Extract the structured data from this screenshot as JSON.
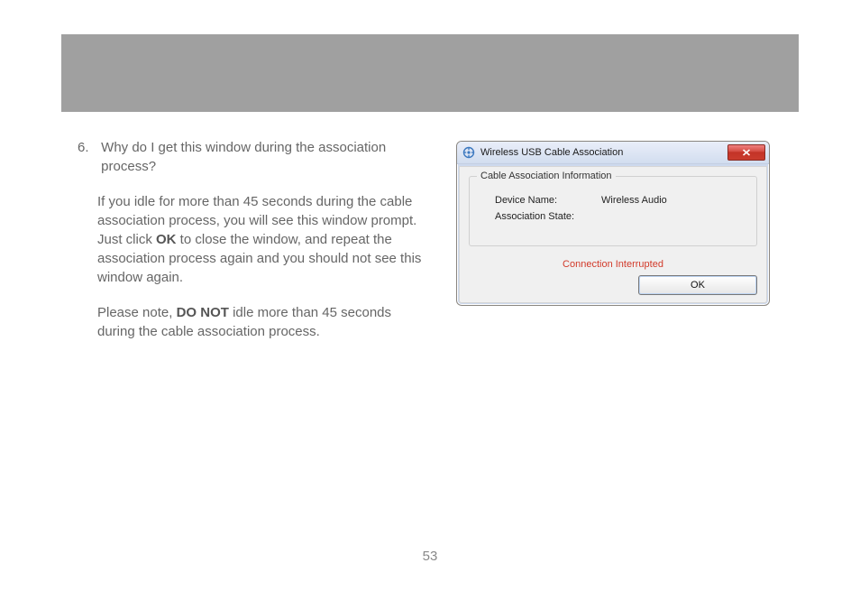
{
  "page_number": "53",
  "faq": {
    "number": "6.",
    "question": "Why do I get this window during the association process?",
    "answer1_pre": "If you idle for more than 45 seconds during the cable association process, you will see this window prompt.  Just click ",
    "answer1_bold": "OK",
    "answer1_post": " to close the window, and repeat the association process again and you should not see this window again.",
    "answer2_pre": "Please note, ",
    "answer2_bold": "DO NOT",
    "answer2_post": " idle more than 45 seconds during the cable association process."
  },
  "dialog": {
    "title": "Wireless USB Cable Association",
    "groupbox_title": "Cable Association Information",
    "device_name_label": "Device Name:",
    "device_name_value": "Wireless Audio",
    "assoc_state_label": "Association State:",
    "assoc_state_value": "",
    "status_message": "Connection Interrupted",
    "ok_label": "OK"
  }
}
